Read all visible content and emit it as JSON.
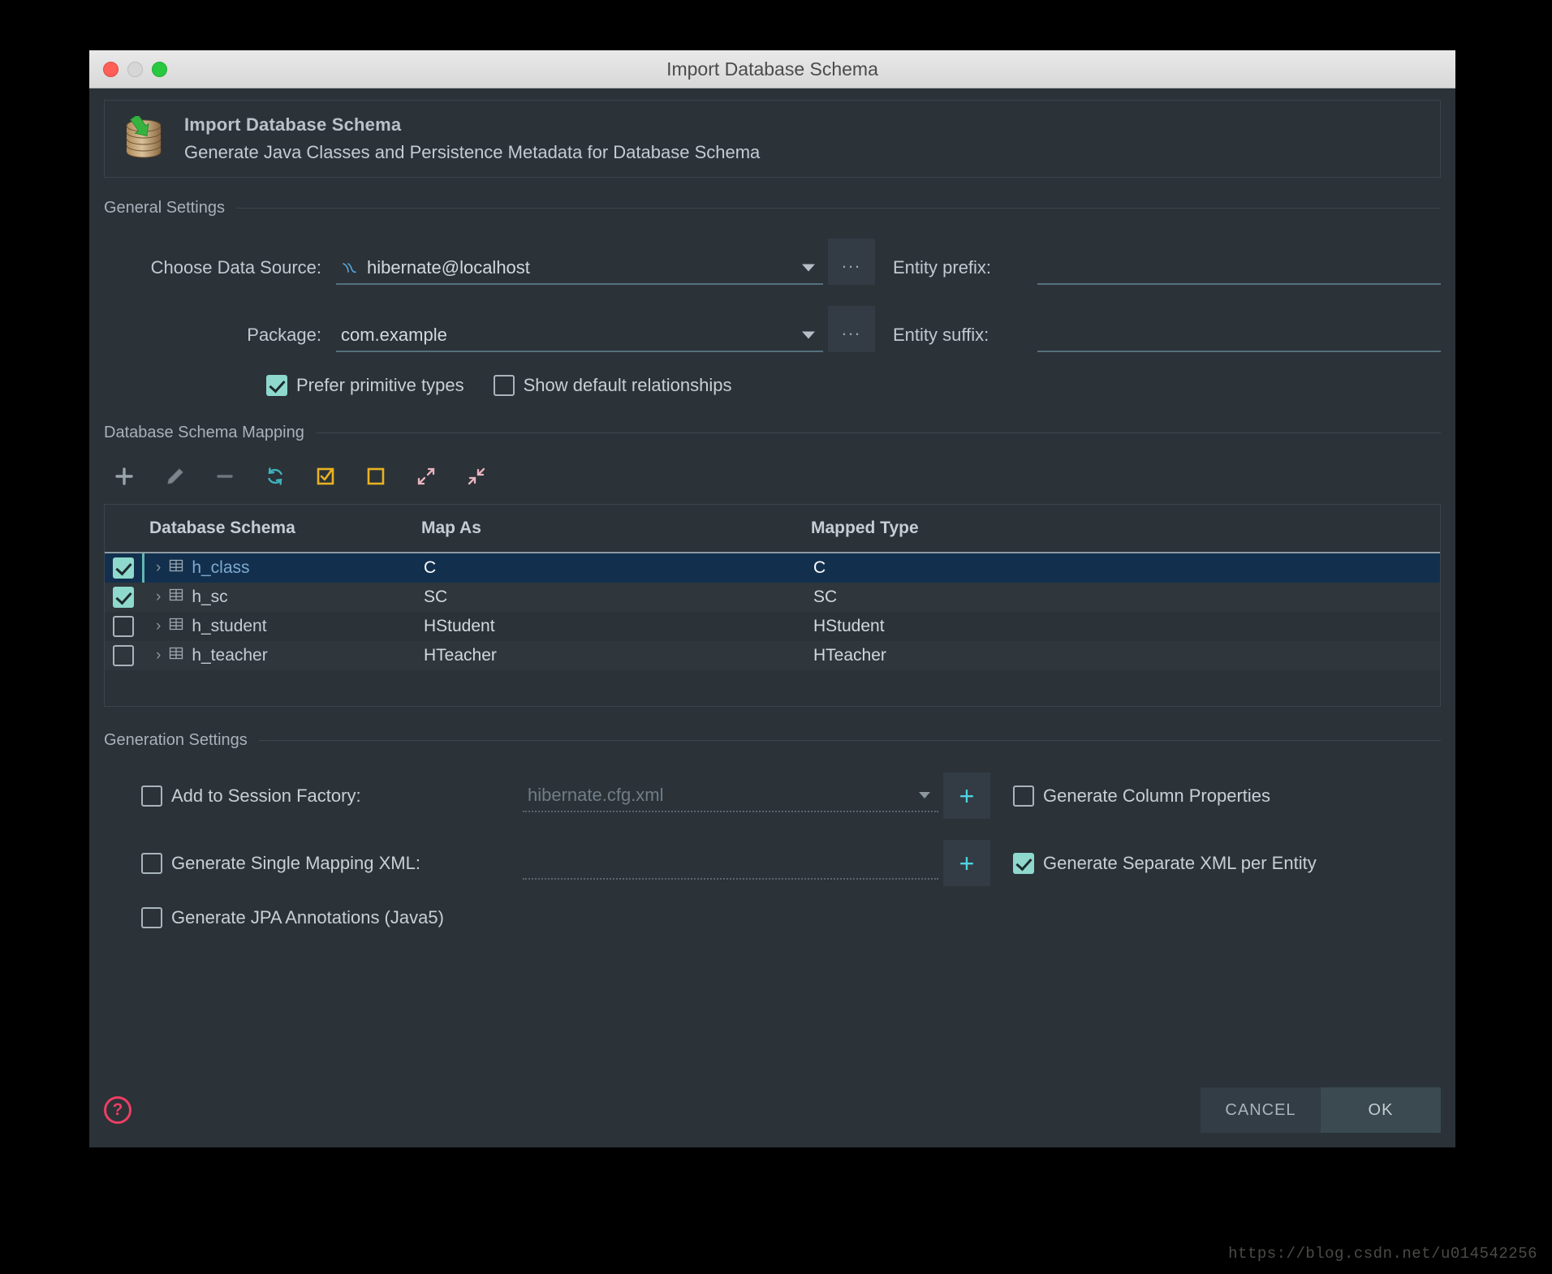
{
  "window": {
    "title": "Import Database Schema",
    "traffic_lights": [
      "close",
      "minimize",
      "maximize"
    ]
  },
  "banner": {
    "icon": "database-import-icon",
    "title": "Import Database Schema",
    "subtitle": "Generate Java Classes and Persistence Metadata for Database Schema"
  },
  "general_settings": {
    "section_label": "General Settings",
    "data_source": {
      "label": "Choose Data Source:",
      "value": "hibernate@localhost",
      "icon": "mysql-dolphin-icon",
      "browse_label": "..."
    },
    "package": {
      "label": "Package:",
      "value": "com.example",
      "browse_label": "..."
    },
    "entity_prefix": {
      "label": "Entity prefix:",
      "value": ""
    },
    "entity_suffix": {
      "label": "Entity suffix:",
      "value": ""
    },
    "prefer_primitive_types": {
      "label": "Prefer primitive types",
      "checked": true,
      "mnemonic": "t"
    },
    "show_default_relationships": {
      "label": "Show default relationships",
      "checked": false,
      "mnemonic": "r"
    }
  },
  "schema_mapping": {
    "section_label": "Database Schema Mapping",
    "toolbar": [
      {
        "name": "add-icon",
        "glyph": "+",
        "color": "#9aa4ab"
      },
      {
        "name": "edit-pencil-icon",
        "glyph": "✎",
        "color": "#7d868d"
      },
      {
        "name": "remove-icon",
        "glyph": "−",
        "color": "#6e777e"
      },
      {
        "name": "refresh-icon",
        "glyph": "⟳",
        "color": "#3fb3bd"
      },
      {
        "name": "select-all-icon",
        "glyph": "☑",
        "color": "#e8b221"
      },
      {
        "name": "deselect-all-icon",
        "glyph": "☐",
        "color": "#e8b221"
      },
      {
        "name": "expand-all-icon",
        "glyph": "⤢",
        "color": "#e8b4bf"
      },
      {
        "name": "collapse-all-icon",
        "glyph": "⤡",
        "color": "#e8b4bf"
      }
    ],
    "columns": [
      "Database Schema",
      "Map As",
      "Mapped Type"
    ],
    "rows": [
      {
        "checked": true,
        "selected": true,
        "name": "h_class",
        "map_as": "C",
        "mapped_type": "C"
      },
      {
        "checked": true,
        "selected": false,
        "name": "h_sc",
        "map_as": "SC",
        "mapped_type": "SC"
      },
      {
        "checked": false,
        "selected": false,
        "name": "h_student",
        "map_as": "HStudent",
        "mapped_type": "HStudent"
      },
      {
        "checked": false,
        "selected": false,
        "name": "h_teacher",
        "map_as": "HTeacher",
        "mapped_type": "HTeacher"
      }
    ]
  },
  "generation_settings": {
    "section_label": "Generation Settings",
    "add_to_session_factory": {
      "label": "Add to Session Factory:",
      "mnemonic": "S",
      "checked": false,
      "value": "hibernate.cfg.xml",
      "add_label": "+"
    },
    "generate_single_mapping_xml": {
      "label": "Generate Single Mapping XML:",
      "mnemonic": "X",
      "checked": false,
      "value": "",
      "add_label": "+"
    },
    "generate_jpa_annotations": {
      "label": "Generate JPA Annotations (Java5)",
      "mnemonic": "A",
      "checked": false
    },
    "generate_column_properties": {
      "label": "Generate Column Properties",
      "checked": false
    },
    "generate_separate_xml_per_entity": {
      "label": "Generate Separate XML per Entity",
      "checked": true
    }
  },
  "footer": {
    "help_label": "?",
    "cancel_label": "CANCEL",
    "ok_label": "OK"
  },
  "watermark": "https://blog.csdn.net/u014542256"
}
